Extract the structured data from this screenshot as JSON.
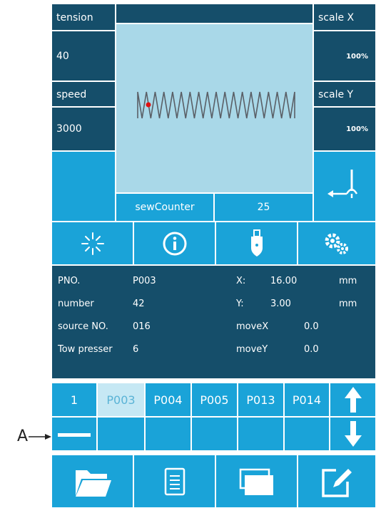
{
  "params": {
    "tension_label": "tension",
    "tension_value": "40",
    "speed_label": "speed",
    "speed_value": "3000",
    "scale_x_label": "scale X",
    "scale_x_value": "100%",
    "scale_y_label": "scale Y",
    "scale_y_value": "100%"
  },
  "counter": {
    "label": "sewCounter",
    "value": "25"
  },
  "toolbar_icons": [
    "sparkle-icon",
    "info-icon",
    "usb-icon",
    "gears-icon"
  ],
  "info": {
    "pno_label": "PNO.",
    "pno_value": "P003",
    "number_label": "number",
    "number_value": "42",
    "source_label": "source NO.",
    "source_value": "016",
    "tow_label": "Tow presser",
    "tow_value": "6",
    "x_label": "X:",
    "x_value": "16.00",
    "x_unit": "mm",
    "y_label": "Y:",
    "y_value": "3.00",
    "y_unit": "mm",
    "movex_label": "moveX",
    "movex_value": "0.0",
    "movey_label": "moveY",
    "movey_value": "0.0"
  },
  "patterns": {
    "page": "1",
    "items": [
      "P003",
      "P004",
      "P005",
      "P013",
      "P014"
    ],
    "selected": "P003"
  },
  "annotation": {
    "label": "A"
  },
  "colors": {
    "panel": "#1aa3d8",
    "dark": "#154e6a",
    "preview": "#a9d8e8",
    "stitch": "#5a5f66",
    "needle_dot": "#e01010"
  },
  "bottom_icons": [
    "folder-icon",
    "document-icon",
    "copy-icon",
    "edit-icon"
  ]
}
